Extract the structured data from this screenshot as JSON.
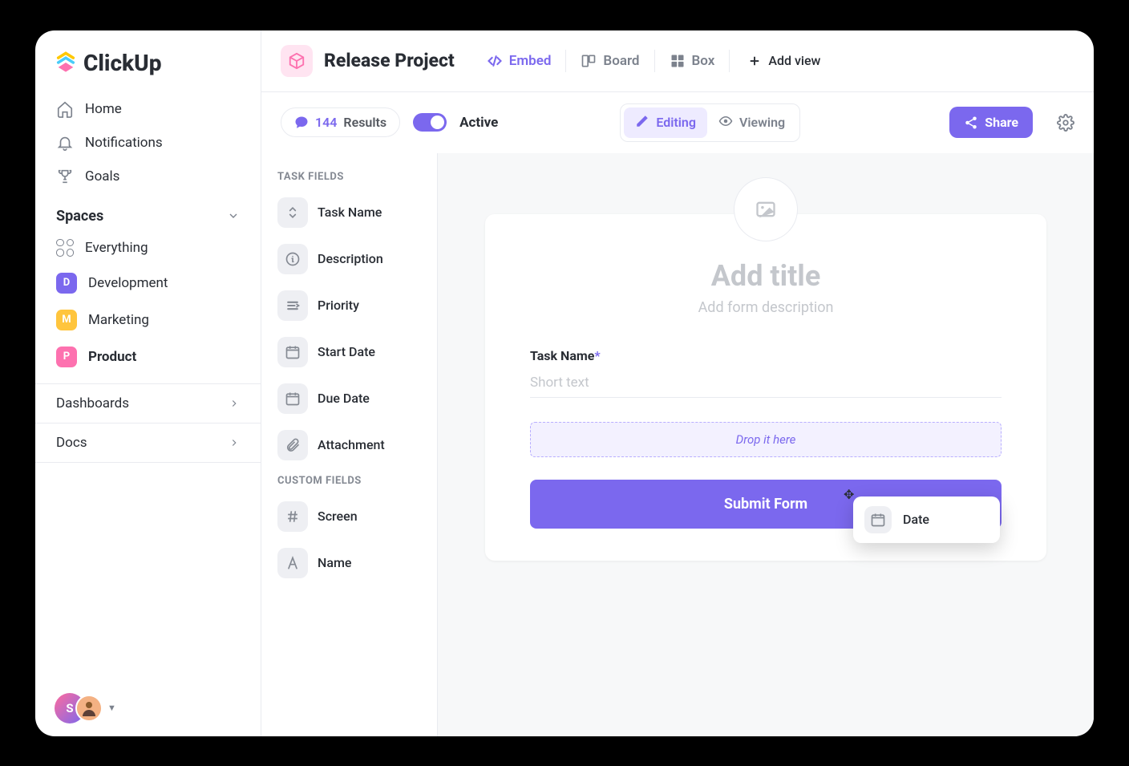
{
  "brand": "ClickUp",
  "nav": [
    {
      "label": "Home",
      "icon": "home"
    },
    {
      "label": "Notifications",
      "icon": "bell"
    },
    {
      "label": "Goals",
      "icon": "trophy"
    }
  ],
  "spaces": {
    "header": "Spaces",
    "everything": "Everything",
    "items": [
      {
        "letter": "D",
        "label": "Development",
        "color": "#7b68ee"
      },
      {
        "letter": "M",
        "label": "Marketing",
        "color": "#ffc53d"
      },
      {
        "letter": "P",
        "label": "Product",
        "color": "#fd71af",
        "bold": true
      }
    ]
  },
  "collapsibles": [
    "Dashboards",
    "Docs"
  ],
  "project": {
    "title": "Release Project"
  },
  "views": [
    {
      "label": "Embed",
      "icon": "embed",
      "active": true
    },
    {
      "label": "Board",
      "icon": "board"
    },
    {
      "label": "Box",
      "icon": "box"
    }
  ],
  "addView": "Add view",
  "results": {
    "count": "144",
    "label": "Results"
  },
  "activeToggle": "Active",
  "modes": [
    {
      "label": "Editing",
      "icon": "pencil",
      "active": true
    },
    {
      "label": "Viewing",
      "icon": "eye"
    }
  ],
  "share": "Share",
  "fieldGroups": [
    {
      "header": "TASK FIELDS",
      "items": [
        {
          "label": "Task Name",
          "icon": "updown"
        },
        {
          "label": "Description",
          "icon": "info"
        },
        {
          "label": "Priority",
          "icon": "priority"
        },
        {
          "label": "Start Date",
          "icon": "calendar"
        },
        {
          "label": "Due Date",
          "icon": "calendar"
        },
        {
          "label": "Attachment",
          "icon": "clip"
        }
      ]
    },
    {
      "header": "CUSTOM FIELDS",
      "items": [
        {
          "label": "Screen",
          "icon": "hash"
        },
        {
          "label": "Name",
          "icon": "letter"
        }
      ]
    }
  ],
  "form": {
    "titlePlaceholder": "Add title",
    "descPlaceholder": "Add form description",
    "taskNameLabel": "Task Name",
    "taskNamePlaceholder": "Short text",
    "dropHint": "Drop it here",
    "submit": "Submit Form"
  },
  "dragChip": "Date",
  "avatar": {
    "initial": "S"
  }
}
